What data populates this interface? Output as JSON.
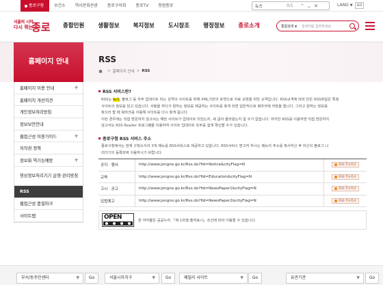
{
  "topbar": {
    "tabs": [
      "종로구청",
      "보건소",
      "역사문화관광",
      "종로구의회",
      "종로TV",
      "청렴종로"
    ],
    "find": {
      "query": "뉴스",
      "count": "0/1",
      "prev": "⌃",
      "next": "⌄",
      "close": "✕"
    },
    "lang": "LANG",
    "go": "GO"
  },
  "logo": {
    "sub1": "서울의 시작",
    "sub2": "다시 뛰는",
    "main": "종로"
  },
  "gnb": [
    "종합민원",
    "생활정보",
    "복지정보",
    "도시창조",
    "행정정보",
    "종로소개"
  ],
  "search": {
    "scope": "통합검색",
    "placeholder": "검색어를 입력하세요."
  },
  "sidebar": {
    "title": "홈페이지 안내",
    "items": [
      {
        "label": "홈페이지 이용 안내",
        "plus": "+"
      },
      {
        "label": "홈페이지 개선의견",
        "plus": ""
      },
      {
        "label": "개인정보처리방침",
        "plus": ""
      },
      {
        "label": "정보보안안내",
        "plus": ""
      },
      {
        "label": "웹접근성 이용가이드",
        "plus": "+"
      },
      {
        "label": "저작권 정책",
        "plus": ""
      },
      {
        "label": "정보화 역기능예방",
        "plus": "+"
      },
      {
        "label": "영상정보처리기기 운영·관리방침",
        "plus": ""
      },
      {
        "label": "RSS",
        "plus": ""
      },
      {
        "label": "웹접근성 품질마크",
        "plus": ""
      },
      {
        "label": "사이트맵",
        "plus": ""
      }
    ]
  },
  "page": {
    "title": "RSS",
    "crumb": [
      "홈페이지 안내",
      "RSS"
    ],
    "sec1_title": "RSS 서비스란?",
    "sec1_p1_pre": "RSS는 ",
    "sec1_p1_hl": "뉴스",
    "sec1_p1_post": ", 블로그 등 자주 업데이트 되는 성격의 사이트를 위해 XML기반의 포맷으로 자료 교환을 위한 규격입니다. RSS규격에 따라 만든 RSS파일은 특정",
    "sec1_p2": "사이트의 정보를 담고 있습니다. 서핑을 하다가 원하는 정보를 제공하는 사이트를 찾게 되면 일반적으로 북마크에 저장을 합니다. 그리고 원하는 정보를",
    "sec1_p3": "찾으러 할 때 북마크를 이용해 사이트를 다시 찾게 됩니다.",
    "sec1_p4": "이런 경우에는 직접 방문하지 않고서는 해당 사이트가 업데이트 되었는지, 새 글이 올라왔는지 알 수가 없습니다. 하지만 RSS를 이용하면 직접 방문하지",
    "sec1_p5": "않고서도 RSS Reader 프로그램을 이용하여 사이트 업데이트 유무를 쉽게 확인할 수가 있습니다.",
    "sec2_title": "종로구청 RSS 서비스 주소",
    "sec2_p1": "종로구청에서는 현재 구청소식의 3개 메뉴를 RSS서비스로 제공하고 있습니다. RSS서비스 받고자 하시는 메뉴의 주소를 복사하신 후 자신의 블로그 나",
    "sec2_p2": "리더기의 등록피에 이용하시기 바랍니다.",
    "rss_rows": [
      {
        "label": "공지 · 행사",
        "url": "http://www.jongno.go.kr/Rss.do?fid=Notice&cityFlag=N",
        "btn": "RSS 주소복사"
      },
      {
        "label": "교육",
        "url": "http://www.jongno.go.kr/Rss.do?fid=Education&cityFlag=N",
        "btn": "RSS 주소복사"
      },
      {
        "label": "고시 · 공고",
        "url": "http://www.jongno.go.kr/Rss.do?fid=NewsPaper1&cityFlag=N",
        "btn": "RSS 주소복사"
      },
      {
        "label": "입법예고",
        "url": "http://www.jongno.go.kr/Rss.do?fid=NewsPaper2&cityFlag=N",
        "btn": "RSS 주소복사"
      }
    ],
    "license_logo": "OPEN",
    "license_text": "본 저작물은 공공누리 「제 1유형:출처표시」조건에 따라 이용할 수 있습니다."
  },
  "footer": {
    "selects": [
      "부서/동주민센터",
      "서울시자치구",
      "패밀리 사이트",
      "유관기관"
    ],
    "go": "Go"
  }
}
